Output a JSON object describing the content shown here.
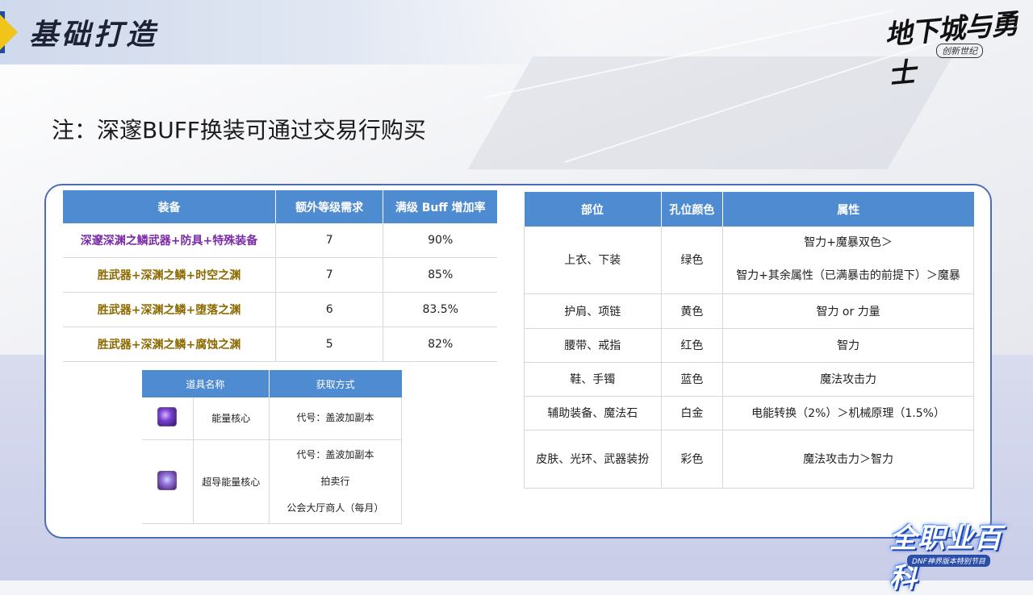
{
  "header": {
    "title": "基础打造",
    "logo_main": "地下城与勇士",
    "logo_sub": "创新世纪"
  },
  "note": "注：深邃BUFF换装可通过交易行购买",
  "equipment_table": {
    "headers": [
      "装备",
      "额外等级需求",
      "满级 Buff 增加率"
    ],
    "rows": [
      {
        "name": "深邃深渊之鳞武器+防具+特殊装备",
        "level": "7",
        "rate": "90%",
        "color": "#7b2aa6"
      },
      {
        "name": "胜武器+深渊之鳞+时空之渊",
        "level": "7",
        "rate": "85%",
        "color": "#8c6a00"
      },
      {
        "name": "胜武器+深渊之鳞+堕落之渊",
        "level": "6",
        "rate": "83.5%",
        "color": "#8c6a00"
      },
      {
        "name": "胜武器+深渊之鳞+腐蚀之渊",
        "level": "5",
        "rate": "82%",
        "color": "#8c6a00"
      }
    ]
  },
  "items_table": {
    "headers": [
      "道具名称",
      "获取方式"
    ],
    "rows": [
      {
        "icon": "energy-core-icon",
        "name": "能量核心",
        "sources": [
          "代号：盖波加副本"
        ]
      },
      {
        "icon": "super-energy-core-icon",
        "name": "超导能量核心",
        "sources": [
          "代号：盖波加副本",
          "拍卖行",
          "公会大厅商人（每月）"
        ]
      }
    ]
  },
  "slots_table": {
    "headers": [
      "部位",
      "孔位颜色",
      "属性"
    ],
    "rows": [
      {
        "part": "上衣、下装",
        "color": "绿色",
        "attr": [
          "智力+魔暴双色＞",
          "智力+其余属性（已满暴击的前提下）＞魔暴"
        ]
      },
      {
        "part": "护肩、项链",
        "color": "黄色",
        "attr": [
          "智力 or 力量"
        ]
      },
      {
        "part": "腰带、戒指",
        "color": "红色",
        "attr": [
          "智力"
        ]
      },
      {
        "part": "鞋、手镯",
        "color": "蓝色",
        "attr": [
          "魔法攻击力"
        ]
      },
      {
        "part": "辅助装备、魔法石",
        "color": "白金",
        "attr": [
          "电能转换（2%）＞机械原理（1.5%）"
        ]
      },
      {
        "part": "皮肤、光环、武器装扮",
        "color": "彩色",
        "attr": [
          "魔法攻击力＞智力"
        ]
      }
    ]
  },
  "badge": {
    "main": "全职业百科",
    "sub": "DNF神界版本特别节目"
  },
  "colors": {
    "header_blue": "#4f8bd0",
    "panel_border": "#4a6fb4",
    "accent_yellow": "#f0c419"
  }
}
